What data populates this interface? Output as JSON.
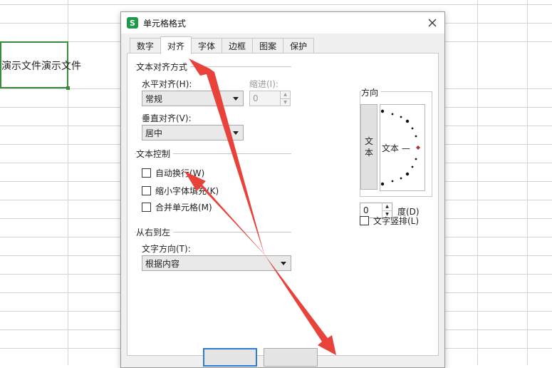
{
  "sheet": {
    "cell_text": "演示文件演示文件"
  },
  "dialog": {
    "title": "单元格格式",
    "app_icon_letter": "S",
    "close_glyph": "✕",
    "tabs": [
      "数字",
      "对齐",
      "字体",
      "边框",
      "图案",
      "保护"
    ],
    "active_tab": "对齐",
    "text_alignment": {
      "group_title": "文本对齐方式",
      "horizontal_label": "水平对齐(H):",
      "horizontal_value": "常规",
      "indent_label": "缩进(I):",
      "indent_value": "0",
      "vertical_label": "垂直对齐(V):",
      "vertical_value": "居中"
    },
    "text_control": {
      "group_title": "文本控制",
      "wrap_text": "自动换行(W)",
      "shrink_to_fit": "缩小字体填充(K)",
      "merge_cells": "合并单元格(M)"
    },
    "rtl": {
      "group_title": "从右到左",
      "direction_label": "文字方向(T):",
      "direction_value": "根据内容"
    },
    "orientation": {
      "group_title": "方向",
      "vertical_text_char1": "文",
      "vertical_text_char2": "本",
      "dial_text": "文本 —",
      "degrees_value": "0",
      "degrees_label": "度(D)",
      "vertical_text_checkbox": "文字竖排(L)"
    }
  },
  "colors": {
    "accent": "#2d7bd5",
    "app_icon": "#1b9a4b",
    "active_cell_border": "#3c8a3c",
    "annotation_arrow": "#e8423b"
  },
  "icons": {
    "close": "close-icon",
    "dropdown": "chevron-down-icon",
    "spinner": "spinner-arrows-icon"
  }
}
